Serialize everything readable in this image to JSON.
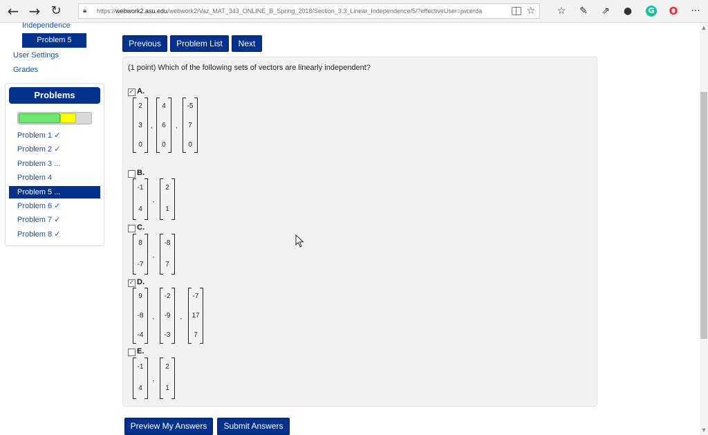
{
  "browser": {
    "url_prefix": "https://",
    "url_host": "webwork2.asu.edu",
    "url_path": "/webwork2/Vaz_MAT_343_ONLINE_B_Spring_2018/Section_3.3_Linear_Independence/5/?effectiveUser=jwcerda",
    "icons": [
      "back-icon",
      "forward-icon",
      "refresh-icon",
      "lock-icon",
      "reading-view-icon",
      "favorite-star-icon",
      "favorites-bar-icon",
      "pen-icon",
      "share-icon",
      "extension-icon",
      "grammarly-icon",
      "opera-icon",
      "more-icon"
    ]
  },
  "sidebar": {
    "partial_label": "Independence",
    "active_top": "Problem 5",
    "links": {
      "user_settings": "User Settings",
      "grades": "Grades"
    },
    "problems_header": "Problems",
    "progress": {
      "correct_fraction": 0.58,
      "pending_fraction": 0.22
    },
    "problems": [
      {
        "label": "Problem 1 ✓"
      },
      {
        "label": "Problem 2 ✓"
      },
      {
        "label": "Problem 3 ..."
      },
      {
        "label": "Problem 4"
      },
      {
        "label": "Problem 5 ..."
      },
      {
        "label": "Problem 6 ✓"
      },
      {
        "label": "Problem 7 ✓"
      },
      {
        "label": "Problem 8 ✓"
      }
    ]
  },
  "nav": {
    "previous": "Previous",
    "problem_list": "Problem List",
    "next": "Next"
  },
  "problem": {
    "question": "(1 point) Which of the following sets of vectors are linearly independent?",
    "options": [
      {
        "letter": "A.",
        "checked": true,
        "vectors": [
          [
            "2",
            "3",
            "0"
          ],
          [
            "4",
            "6",
            "0"
          ],
          [
            "-5",
            "7",
            "0"
          ]
        ]
      },
      {
        "letter": "B.",
        "checked": false,
        "vectors": [
          [
            "-1",
            "4"
          ],
          [
            "2",
            "1"
          ]
        ]
      },
      {
        "letter": "C.",
        "checked": false,
        "vectors": [
          [
            "8",
            "-7"
          ],
          [
            "-8",
            "7"
          ]
        ]
      },
      {
        "letter": "D.",
        "checked": true,
        "vectors": [
          [
            "9",
            "-8",
            "-4"
          ],
          [
            "-2",
            "-9",
            "-3"
          ],
          [
            "-7",
            "17",
            "7"
          ]
        ]
      },
      {
        "letter": "E.",
        "checked": false,
        "vectors": [
          [
            "-1",
            "4"
          ],
          [
            "2",
            "1"
          ]
        ]
      }
    ]
  },
  "actions": {
    "preview": "Preview My Answers",
    "submit": "Submit Answers"
  },
  "checkmark": "✓",
  "comma": ","
}
